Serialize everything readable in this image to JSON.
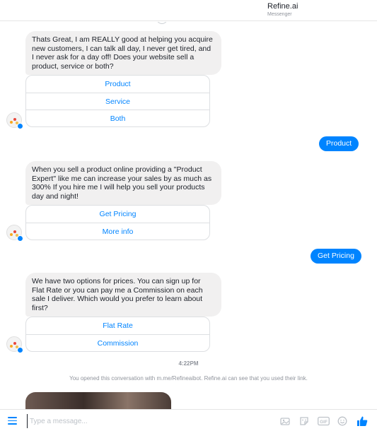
{
  "header": {
    "title": "Refine.ai",
    "subtitle": "Messenger"
  },
  "messages": {
    "bot1": {
      "text": "Thats Great, I am REALLY good at helping you acquire new customers, I can talk all day, I never get tired, and I never ask for a day off! Does your website sell a product,  service or both?",
      "quick_replies": [
        "Product",
        "Service",
        "Both"
      ]
    },
    "user1": "Product",
    "bot2": {
      "text": "When you sell a product online providing a \"Product Expert\" like me can increase your sales by as much as 300% If you hire me I will help you sell your products day and night!",
      "quick_replies": [
        "Get Pricing",
        "More info"
      ]
    },
    "user2": "Get Pricing",
    "bot3": {
      "text": "We have two options for prices. You can sign up for Flat Rate or you can pay me a Commission on each sale I deliver. Which would you prefer to learn about first?",
      "quick_replies": [
        "Flat Rate",
        "Commission"
      ]
    }
  },
  "timestamp": "4:22PM",
  "notice": "You opened this conversation with m.me/Refineaibot. Refine.ai can see that you used their link.",
  "composer": {
    "placeholder": "Type a message..."
  },
  "icons": [
    "menu-icon",
    "image-icon",
    "sticker-icon",
    "gif-icon",
    "emoji-icon",
    "like-icon"
  ],
  "colors": {
    "accent": "#0084ff",
    "bot_bubble": "#f1f0f0"
  }
}
